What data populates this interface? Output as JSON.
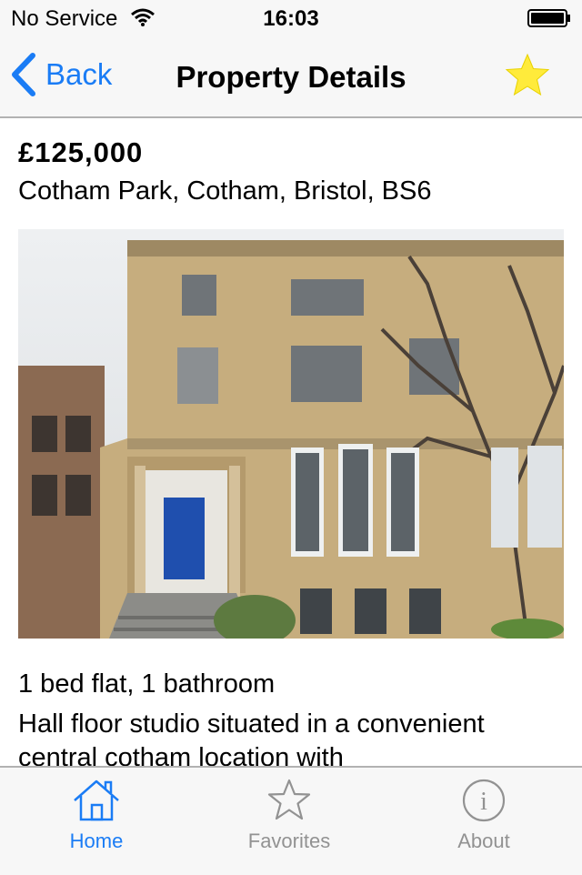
{
  "status_bar": {
    "carrier": "No Service",
    "time": "16:03"
  },
  "nav": {
    "back_label": "Back",
    "title": "Property Details"
  },
  "property": {
    "price": "£125,000",
    "address": "Cotham Park, Cotham, Bristol, BS6",
    "summary": "1 bed flat, 1 bathroom",
    "description": "Hall floor studio situated in a convenient central cotham location with"
  },
  "tabs": [
    {
      "label": "Home",
      "icon": "house-icon",
      "selected": true
    },
    {
      "label": "Favorites",
      "icon": "star-outline-icon",
      "selected": false
    },
    {
      "label": "About",
      "icon": "info-icon",
      "selected": false
    }
  ],
  "colors": {
    "accent": "#1a7cf5",
    "star": "#ffeb3b",
    "tab_inactive": "#929292",
    "bar_background": "#f7f7f7"
  }
}
